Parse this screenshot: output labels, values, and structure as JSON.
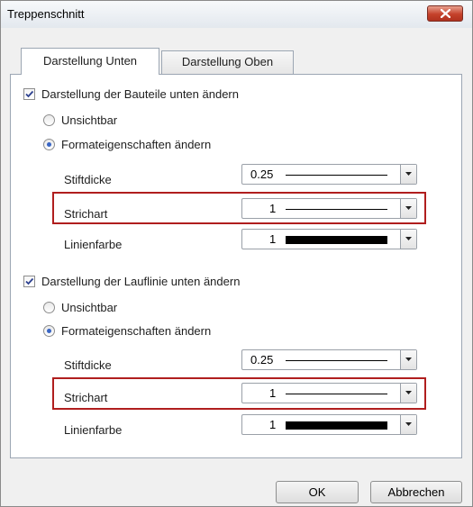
{
  "window": {
    "title": "Treppenschnitt",
    "close_icon": "close-icon"
  },
  "tabs": [
    {
      "label": "Darstellung Unten",
      "active": true
    },
    {
      "label": "Darstellung Oben",
      "active": false
    }
  ],
  "sections": [
    {
      "checkbox_label": "Darstellung der Bauteile unten ändern",
      "checked": true,
      "radio_invisible": "Unsichtbar",
      "radio_format": "Formateigenschaften ändern",
      "selected_radio": "format",
      "rows": [
        {
          "label": "Stiftdicke",
          "value": "0.25",
          "preview": "line"
        },
        {
          "label": "Strichart",
          "value": "1",
          "preview": "line",
          "highlighted": true
        },
        {
          "label": "Linienfarbe",
          "value": "1",
          "preview": "color",
          "color": "#000000"
        }
      ]
    },
    {
      "checkbox_label": "Darstellung der Lauflinie unten ändern",
      "checked": true,
      "radio_invisible": "Unsichtbar",
      "radio_format": "Formateigenschaften ändern",
      "selected_radio": "format",
      "rows": [
        {
          "label": "Stiftdicke",
          "value": "0.25",
          "preview": "line"
        },
        {
          "label": "Strichart",
          "value": "1",
          "preview": "line",
          "highlighted": true
        },
        {
          "label": "Linienfarbe",
          "value": "1",
          "preview": "color",
          "color": "#000000"
        }
      ]
    }
  ],
  "buttons": {
    "ok": "OK",
    "cancel": "Abbrechen"
  },
  "colors": {
    "highlight": "#b01e1e",
    "radio_dot": "#3a66c4",
    "close_button": "#c5412b"
  }
}
